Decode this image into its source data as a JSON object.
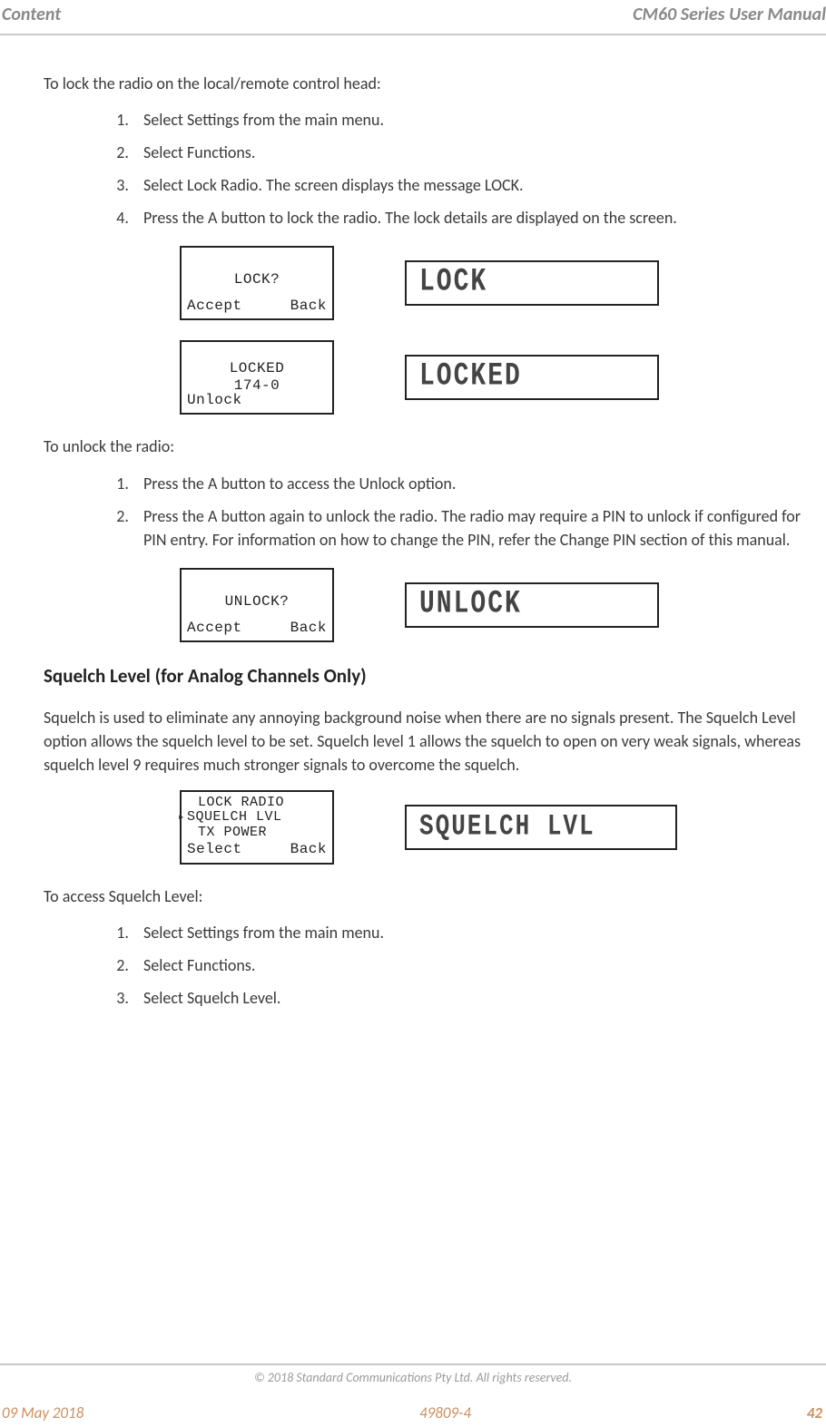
{
  "header": {
    "left": "Content",
    "right": "CM60 Series User Manual"
  },
  "intro_lock": "To lock the radio on the local/remote control head:",
  "lock_steps": [
    "Select Settings from the main menu.",
    "Select Functions.",
    "Select Lock Radio. The screen displays the message LOCK.",
    "Press the A button to lock the radio. The lock details are displayed on the screen."
  ],
  "screen1": {
    "lcd": {
      "title": "LOCK?",
      "left": "Accept",
      "right": "Back"
    },
    "seg": "LOCK"
  },
  "screen2": {
    "lcd": {
      "title": "LOCKED",
      "sub": "174-0",
      "left": "Unlock"
    },
    "seg": "LOCKED"
  },
  "intro_unlock": "To unlock the radio:",
  "unlock_steps": [
    "Press the A button to access the Unlock option.",
    "Press the A button again to unlock the radio. The radio may require a PIN to unlock if configured for PIN entry. For information on how to change the PIN, refer the Change PIN section of this manual."
  ],
  "screen3": {
    "lcd": {
      "title": "UNLOCK?",
      "left": "Accept",
      "right": "Back"
    },
    "seg": "UNLOCK"
  },
  "section_title": "Squelch Level (for Analog Channels Only)",
  "squelch_para": "Squelch is used to eliminate any annoying background noise when there are no signals present. The Squelch Level option allows the squelch level to be set. Squelch level 1 allows the squelch to open on very weak signals, whereas squelch level 9 requires much stronger signals to overcome the squelch.",
  "screen4": {
    "lcd": {
      "line1": "LOCK RADIO",
      "line2": "SQUELCH LVL",
      "line3": "TX POWER",
      "left": "Select",
      "right": "Back"
    },
    "seg": "SQUELCH LVL"
  },
  "intro_access": "To access Squelch Level:",
  "access_steps": [
    "Select Settings from the main menu.",
    "Select Functions.",
    "Select Squelch Level."
  ],
  "copyright": "© 2018 Standard Communications Pty Ltd. All rights reserved.",
  "footer": {
    "date": "09 May 2018",
    "doc": "49809-4",
    "page": "42"
  }
}
